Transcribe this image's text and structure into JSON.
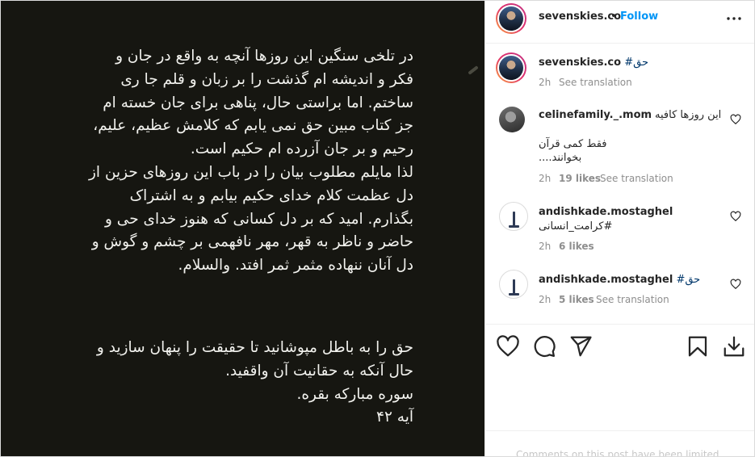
{
  "post": {
    "paragraph_1": "در تلخی سنگین این روزها آنچه به واقع در جان و\nفکر و اندیشه ام گذشت را بر زبان و قلم جا ری\nساختم. اما براستی حال، پناهی برای جان خسته ام\nجز کتاب مبین حق نمی یابم که کلامش عظیم، علیم،\nرحیم و بر جان آزرده ام حکیم است.\nلذا مایلم مطلوب بیان را در باب این روزهای حزین از\nدل عظمت کلام خدای حکیم بیابم و  به اشتراک\nبگذارم. امید که بر دل کسانی که هنوز خدای حی و\nحاضر و ناظر به قهر، مهر نافهمی بر چشم و گوش و\nدل آنان ننهاده مثمر ثمر افتد. والسلام.",
    "paragraph_2": "حق را به باطل مپوشانید تا حقیقت را پنهان سازید و\nحال آنکه به حقانیت آن واقفید.\nسوره مبارکه بقره.\nآیه ۴۲"
  },
  "header": {
    "username": "sevenskies.co",
    "separator": "•",
    "follow_label": "Follow",
    "more_icon": "more-horizontal-icon"
  },
  "caption": {
    "username": "sevenskies.co",
    "hashtag": "#حق",
    "time": "2h",
    "translate": "See translation"
  },
  "comments": [
    {
      "username": "celinefamily._.mom",
      "text_line_1": "این روزها کافیه",
      "text_line_2": "فقط کمی قرآن",
      "text_line_3": "بخوانند....",
      "time": "2h",
      "likes": "19 likes",
      "translate": "See translation"
    },
    {
      "username": "andishkade.mostaghel",
      "text_line_1": "#کرامت_انسانی",
      "time": "2h",
      "likes": "6 likes"
    },
    {
      "username": "andishkade.mostaghel",
      "text_line_1": "#حق",
      "time": "2h",
      "likes": "5 likes",
      "translate": "See translation"
    }
  ],
  "actions": {
    "like_icon": "heart-icon",
    "comment_icon": "comment-icon",
    "share_icon": "share-icon",
    "save_icon": "bookmark-icon",
    "download_icon": "download-icon"
  },
  "footer": {
    "text": "Comments on this post have been limited."
  },
  "colors": {
    "media_background": "#161611",
    "media_text": "#f2f2ee",
    "link_blue": "#0095f6",
    "hashtag_blue": "#00376b",
    "muted": "#8e8e8e"
  }
}
